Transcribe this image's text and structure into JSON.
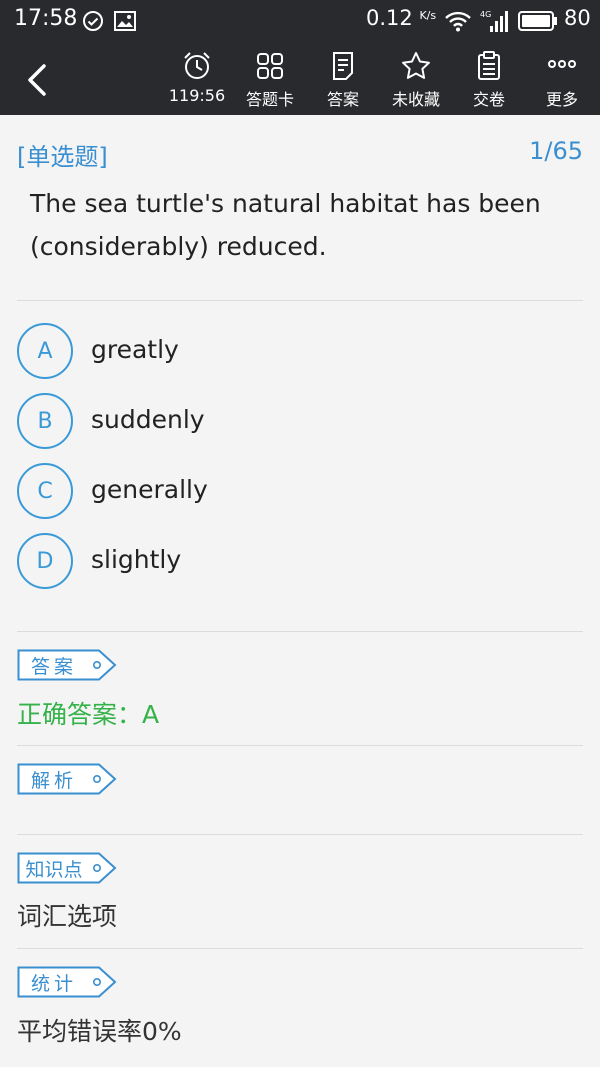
{
  "status_bar": {
    "time": "17:58",
    "speed_value": "0.12",
    "speed_unit": "K/s",
    "network": "4G",
    "battery": "80"
  },
  "toolbar": {
    "timer": "119:56",
    "answer_card": "答题卡",
    "answer": "答案",
    "favorite": "未收藏",
    "submit": "交卷",
    "more": "更多"
  },
  "question": {
    "type": "[单选题]",
    "number": "1/65",
    "text": "The sea turtle's natural habitat has been (considerably) reduced.",
    "options": [
      {
        "letter": "A",
        "text": "greatly"
      },
      {
        "letter": "B",
        "text": "suddenly"
      },
      {
        "letter": "C",
        "text": "generally"
      },
      {
        "letter": "D",
        "text": "slightly"
      }
    ]
  },
  "sections": {
    "answer_tag": "答案",
    "correct_answer": "正确答案：A",
    "analysis_tag": "解析",
    "knowledge_tag": "知识点",
    "knowledge_text": "词汇选项",
    "stats_tag": "统计",
    "stats_text": "平均错误率0%"
  },
  "colors": {
    "accent": "#3a8fd0",
    "correct": "#35b24a",
    "toolbar_bg": "#282a2d"
  }
}
